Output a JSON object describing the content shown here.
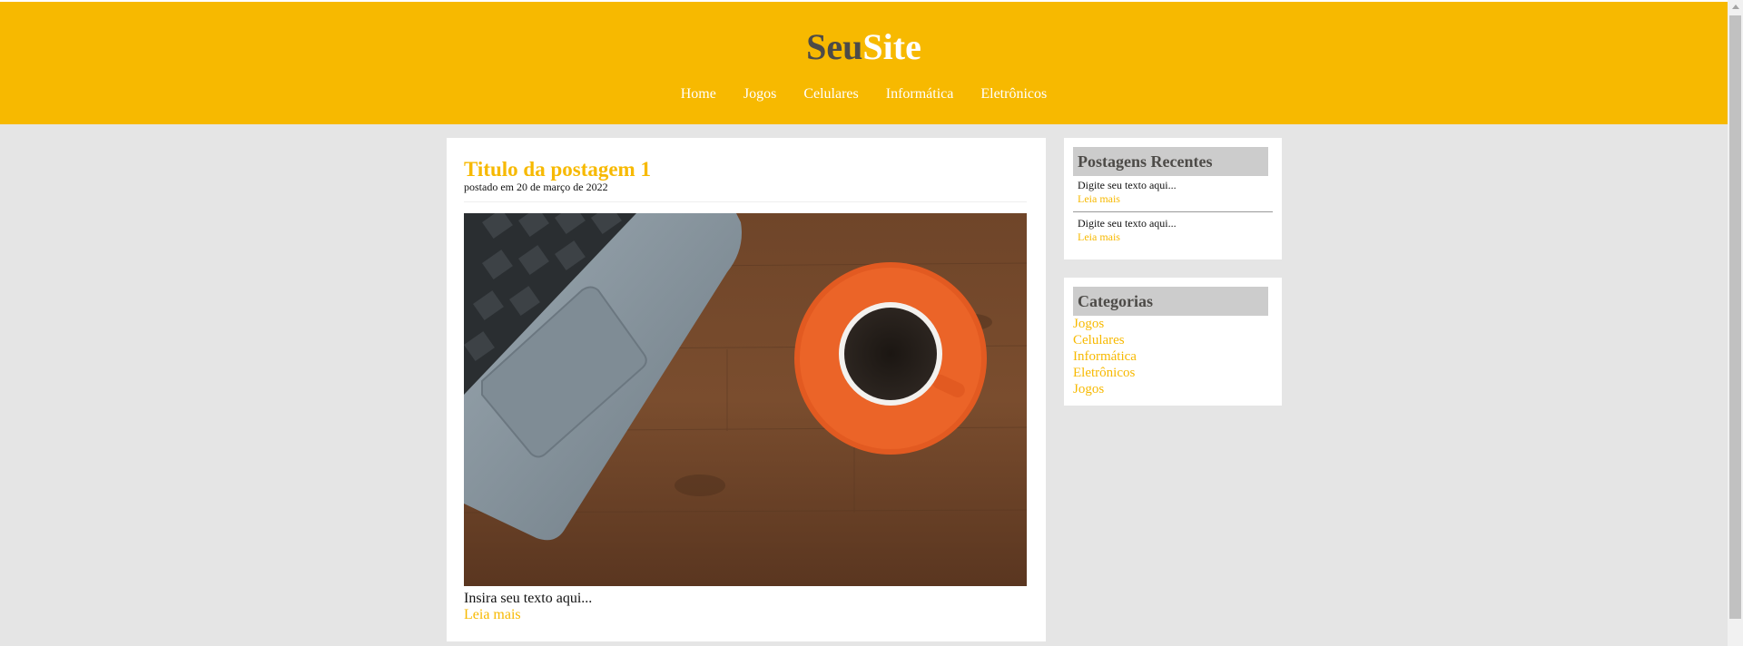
{
  "header": {
    "logo_part1": "Seu",
    "logo_part2": "Site",
    "nav": [
      "Home",
      "Jogos",
      "Celulares",
      "Informática",
      "Eletrônicos"
    ]
  },
  "post": {
    "title": "Titulo da postagem 1",
    "date": "postado em 20 de março de 2022",
    "text": "Insira seu texto aqui...",
    "read_more": "Leia mais"
  },
  "recent": {
    "title": "Postagens Recentes",
    "items": [
      {
        "text": "Digite seu texto aqui...",
        "more": "Leia mais"
      },
      {
        "text": "Digite seu texto aqui...",
        "more": "Leia mais"
      }
    ]
  },
  "categories": {
    "title": "Categorias",
    "items": [
      "Jogos",
      "Celulares",
      "Informática",
      "Eletrônicos",
      "Jogos"
    ]
  },
  "colors": {
    "accent": "#f7b900",
    "logo_dark": "#4d4b48",
    "page_bg": "#e5e5e5",
    "widget_head_bg": "#cccccc"
  }
}
